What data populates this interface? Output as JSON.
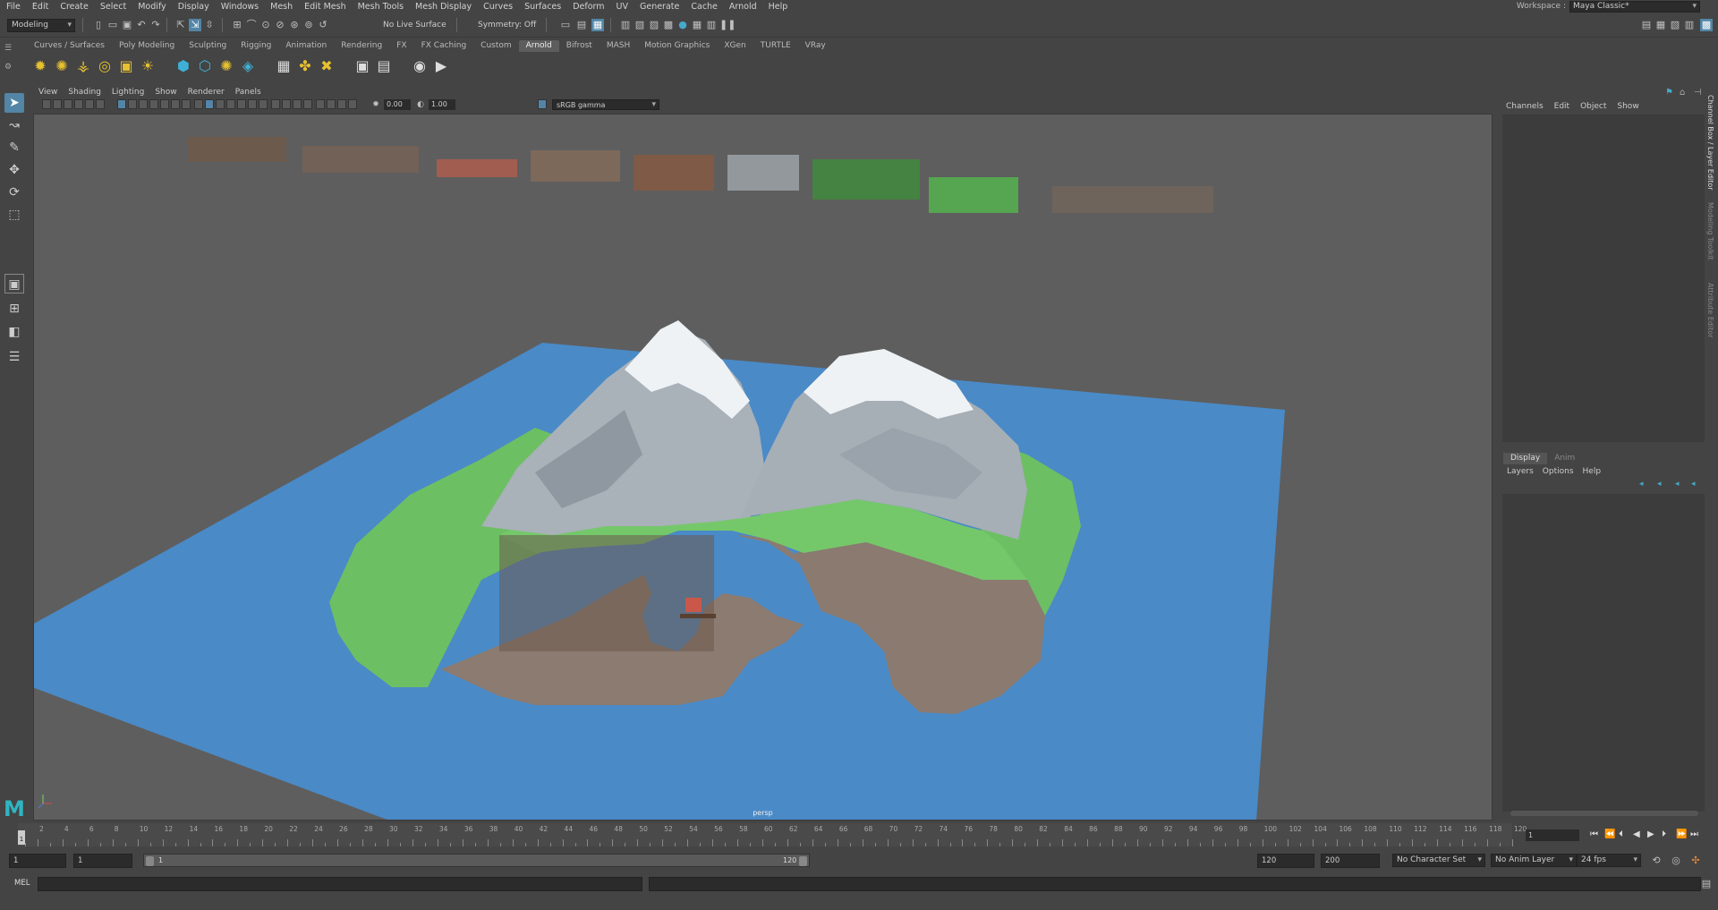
{
  "menubar": {
    "items": [
      "File",
      "Edit",
      "Create",
      "Select",
      "Modify",
      "Display",
      "Windows",
      "Mesh",
      "Edit Mesh",
      "Mesh Tools",
      "Mesh Display",
      "Curves",
      "Surfaces",
      "Deform",
      "UV",
      "Generate",
      "Cache",
      "Arnold",
      "Help"
    ],
    "workspace_label": "Workspace :",
    "workspace_value": "Maya Classic*"
  },
  "statusline": {
    "menuset": "Modeling",
    "live_surface": "No Live Surface",
    "symmetry": "Symmetry: Off"
  },
  "shelf": {
    "tabs": [
      "Curves / Surfaces",
      "Poly Modeling",
      "Sculpting",
      "Rigging",
      "Animation",
      "Rendering",
      "FX",
      "FX Caching",
      "Custom",
      "Arnold",
      "Bifrost",
      "MASH",
      "Motion Graphics",
      "XGen",
      "TURTLE",
      "VRay"
    ],
    "active_tab": "Arnold"
  },
  "viewport": {
    "menus": [
      "View",
      "Shading",
      "Lighting",
      "Show",
      "Renderer",
      "Panels"
    ],
    "exposure": "0.00",
    "gamma": "1.00",
    "color_space": "sRGB gamma",
    "camera": "persp"
  },
  "channel_box": {
    "menus": [
      "Channels",
      "Edit",
      "Object",
      "Show"
    ]
  },
  "side_tabs": [
    "Channel Box / Layer Editor",
    "Modeling Toolkit",
    "Attribute Editor"
  ],
  "layer_editor": {
    "tabs": [
      "Display",
      "Anim"
    ],
    "menus": [
      "Layers",
      "Options",
      "Help"
    ]
  },
  "timeline": {
    "ticks": [
      "2",
      "4",
      "6",
      "8",
      "10",
      "12",
      "14",
      "16",
      "18",
      "20",
      "22",
      "24",
      "26",
      "28",
      "30",
      "32",
      "34",
      "36",
      "38",
      "40",
      "42",
      "44",
      "46",
      "48",
      "50",
      "52",
      "54",
      "56",
      "58",
      "60",
      "62",
      "64",
      "66",
      "68",
      "70",
      "72",
      "74",
      "76",
      "78",
      "80",
      "82",
      "84",
      "86",
      "88",
      "90",
      "92",
      "94",
      "96",
      "98",
      "100",
      "102",
      "104",
      "106",
      "108",
      "110",
      "112",
      "114",
      "116",
      "118",
      "120"
    ],
    "current_frame_marker": "1",
    "current_frame": "1"
  },
  "range": {
    "start": "1",
    "playback_start": "1",
    "slider_start": "1",
    "slider_end": "120",
    "playback_end": "120",
    "end": "200",
    "character_set": "No Character Set",
    "anim_layer": "No Anim Layer",
    "fps": "24 fps"
  },
  "cmdline": {
    "label": "MEL"
  },
  "colors": {
    "highlight": "#5285a6",
    "water": "#4a8ac7",
    "grass": "#6dbf63",
    "rock": "#a9b1b9",
    "ground": "#8c7b70",
    "viewport_bg": "#5e5e5e"
  }
}
